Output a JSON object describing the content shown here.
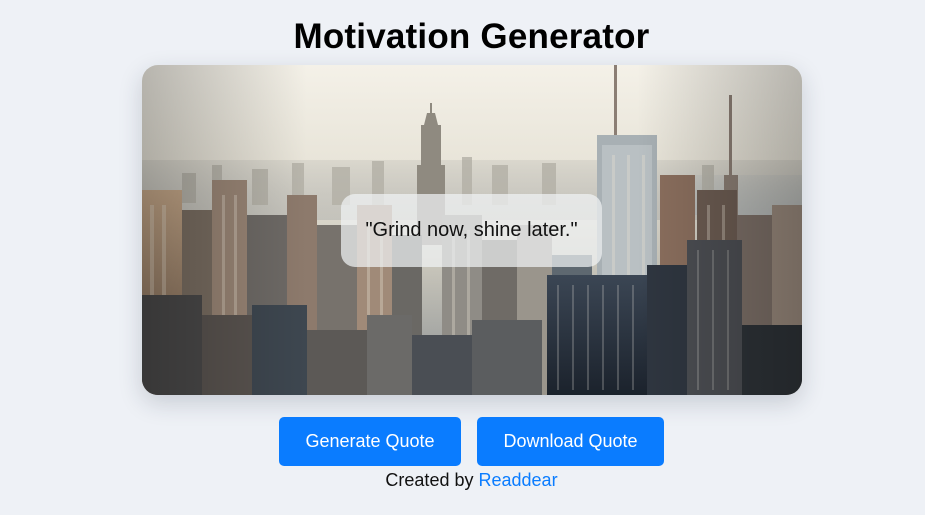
{
  "app": {
    "title": "Motivation Generator"
  },
  "card": {
    "image": "city-skyline-photo",
    "quote": "\"Grind now, shine later.\""
  },
  "buttons": {
    "generate_label": "Generate Quote",
    "download_label": "Download Quote"
  },
  "footer": {
    "prefix": "Created by",
    "author": "Readdear"
  },
  "colors": {
    "background": "#eef1f6",
    "accent": "#0a7cff",
    "title": "#000000"
  }
}
